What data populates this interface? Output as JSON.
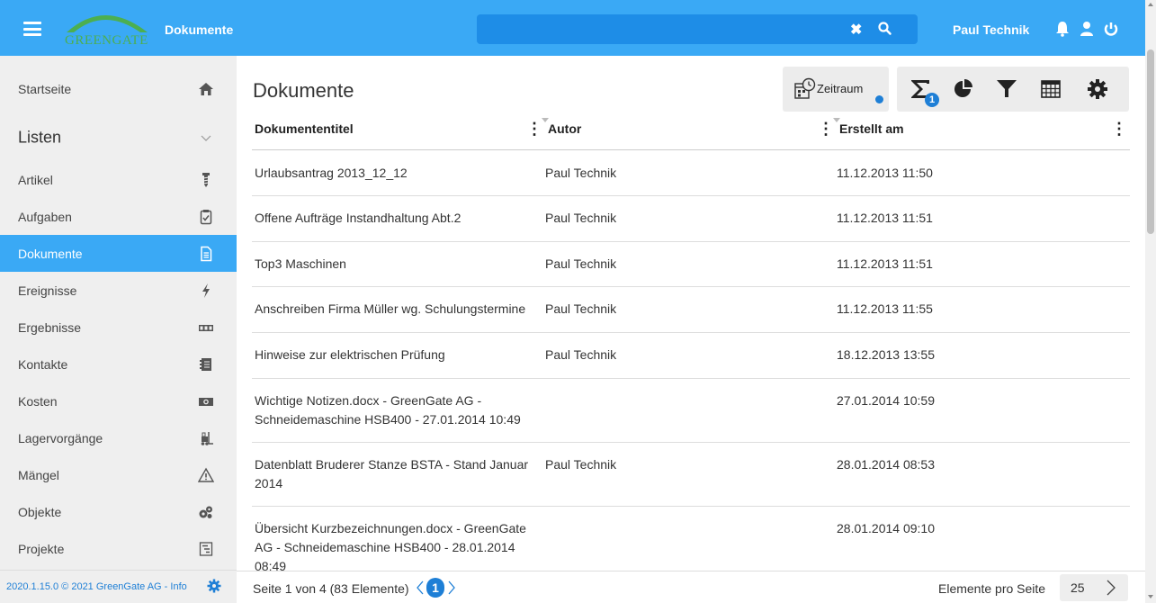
{
  "header": {
    "logo_text": "GREENGATE",
    "app_title": "Dokumente",
    "search": {
      "value": "",
      "placeholder": ""
    },
    "user_name": "Paul Technik",
    "colors": {
      "topbar": "#3aa9f5",
      "search": "#1e8de7",
      "accent": "#1e7fd6"
    }
  },
  "sidebar": {
    "items": [
      {
        "label": "Startseite",
        "icon": "home-icon"
      },
      {
        "label": "Listen",
        "icon": "chevron-down-icon",
        "section": true
      },
      {
        "label": "Artikel",
        "icon": "screw-icon"
      },
      {
        "label": "Aufgaben",
        "icon": "clipboard-check-icon"
      },
      {
        "label": "Dokumente",
        "icon": "document-icon",
        "active": true
      },
      {
        "label": "Ereignisse",
        "icon": "lightning-icon"
      },
      {
        "label": "Ergebnisse",
        "icon": "counter-icon"
      },
      {
        "label": "Kontakte",
        "icon": "address-book-icon"
      },
      {
        "label": "Kosten",
        "icon": "money-icon"
      },
      {
        "label": "Lagervorgänge",
        "icon": "forklift-icon"
      },
      {
        "label": "Mängel",
        "icon": "warning-icon"
      },
      {
        "label": "Objekte",
        "icon": "gears-icon"
      },
      {
        "label": "Projekte",
        "icon": "gantt-icon"
      }
    ],
    "footer": "2020.1.15.0 © 2021 GreenGate AG - Info"
  },
  "main": {
    "title": "Dokumente",
    "zeitraum_label": "Zeitraum",
    "sum_badge": "1",
    "columns": [
      "Dokumententitel",
      "Autor",
      "Erstellt am"
    ],
    "rows": [
      {
        "title": "Urlaubsantrag 2013_12_12",
        "autor": "Paul Technik",
        "date": "11.12.2013 11:50"
      },
      {
        "title": "Offene Aufträge Instandhaltung Abt.2",
        "autor": "Paul Technik",
        "date": "11.12.2013 11:51"
      },
      {
        "title": "Top3 Maschinen",
        "autor": "Paul Technik",
        "date": "11.12.2013 11:51"
      },
      {
        "title": "Anschreiben Firma Müller wg. Schulungstermine",
        "autor": "Paul Technik",
        "date": "11.12.2013 11:55"
      },
      {
        "title": "Hinweise zur elektrischen Prüfung",
        "autor": "Paul Technik",
        "date": "18.12.2013 13:55"
      },
      {
        "title": "Wichtige Notizen.docx - GreenGate AG - Schneidemaschine HSB400 - 27.01.2014 10:49",
        "autor": "",
        "date": "27.01.2014 10:59"
      },
      {
        "title": "Datenblatt Bruderer Stanze BSTA - Stand Januar 2014",
        "autor": "Paul Technik",
        "date": "28.01.2014 08:53"
      },
      {
        "title": "Übersicht Kurzbezeichnungen.docx - GreenGate AG - Schneidemaschine HSB400 - 28.01.2014 08:49",
        "autor": "",
        "date": "28.01.2014 09:10"
      }
    ]
  },
  "pager": {
    "summary": "Seite 1 von 4 (83 Elemente)",
    "current_page": "1",
    "per_page_label": "Elemente pro Seite",
    "per_page_value": "25"
  }
}
